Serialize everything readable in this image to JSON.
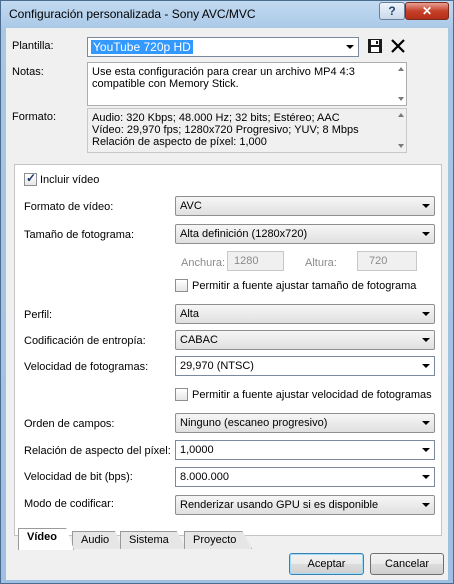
{
  "window": {
    "title": "Configuración personalizada - Sony AVC/MVC",
    "help_label": "?",
    "close_label": "✕"
  },
  "template": {
    "label": "Plantilla:",
    "value": "YouTube 720p HD"
  },
  "notes": {
    "label": "Notas:",
    "text": "Use esta configuración para crear un archivo MP4 4:3 compatible con Memory Stick."
  },
  "format": {
    "label": "Formato:",
    "lines": [
      "Audio: 320 Kbps; 48.000 Hz; 32 bits; Estéreo; AAC",
      "Vídeo: 29,970 fps; 1280x720 Progresivo; YUV; 8 Mbps",
      "Relación de aspecto de píxel: 1,000"
    ]
  },
  "video": {
    "include_video_label": "Incluir vídeo",
    "include_video_checked": true,
    "video_format": {
      "label": "Formato de vídeo:",
      "value": "AVC"
    },
    "frame_size": {
      "label": "Tamaño de fotograma:",
      "value": "Alta definición (1280x720)"
    },
    "width": {
      "label": "Anchura:",
      "value": "1280"
    },
    "height": {
      "label": "Altura:",
      "value": "720"
    },
    "allow_frame_size_label": "Permitir a fuente ajustar tamaño de fotograma",
    "allow_frame_size_checked": false,
    "profile": {
      "label": "Perfil:",
      "value": "Alta"
    },
    "entropy": {
      "label": "Codificación de entropía:",
      "value": "CABAC"
    },
    "frame_rate": {
      "label": "Velocidad de fotogramas:",
      "value": "29,970 (NTSC)"
    },
    "allow_frame_rate_label": "Permitir a fuente ajustar velocidad de fotogramas",
    "allow_frame_rate_checked": false,
    "field_order": {
      "label": "Orden de campos:",
      "value": "Ninguno (escaneo progresivo)"
    },
    "pixel_aspect": {
      "label": "Relación de aspecto del píxel:",
      "value": "1,0000"
    },
    "bit_rate": {
      "label": "Velocidad de bit (bps):",
      "value": "8.000.000"
    },
    "encode_mode": {
      "label": "Modo de codificar:",
      "value": "Renderizar usando GPU si es disponible"
    }
  },
  "tabs": [
    {
      "label": "Vídeo",
      "active": true
    },
    {
      "label": "Audio",
      "active": false
    },
    {
      "label": "Sistema",
      "active": false
    },
    {
      "label": "Proyecto",
      "active": false
    }
  ],
  "buttons": {
    "accept": "Aceptar",
    "cancel": "Cancelar"
  },
  "icons": {
    "save": "floppy-disk-icon",
    "delete": "x-delete-icon"
  }
}
